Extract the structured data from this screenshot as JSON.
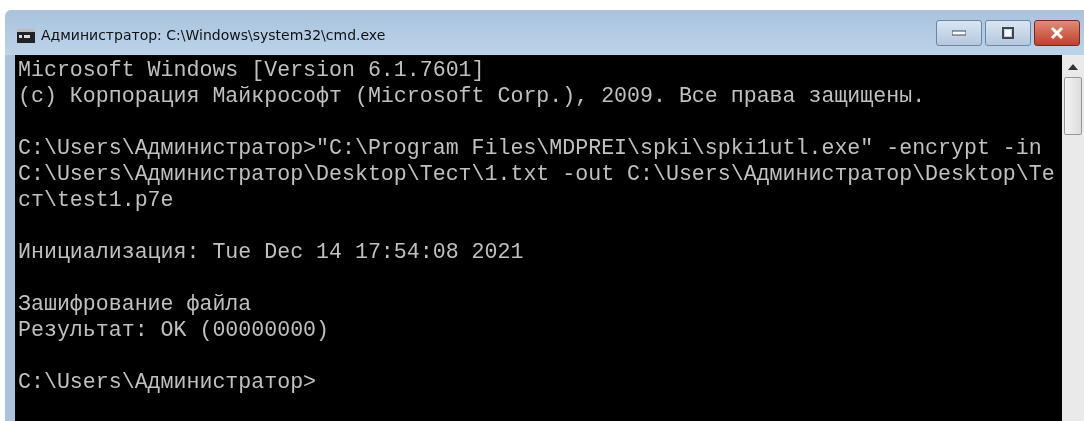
{
  "window": {
    "title": "Администратор: C:\\Windows\\system32\\cmd.exe"
  },
  "console": {
    "blocks": [
      [
        "Microsoft Windows [Version 6.1.7601]",
        "(c) Корпорация Майкрософт (Microsoft Corp.), 2009. Все права защищены."
      ],
      [
        "C:\\Users\\Администратор>\"C:\\Program Files\\MDPREI\\spki\\spki1utl.exe\" -encrypt -in",
        "C:\\Users\\Администратор\\Desktop\\Тест\\1.txt -out C:\\Users\\Администратор\\Desktop\\Те",
        "ст\\test1.p7e"
      ],
      [
        "Инициализация: Tue Dec 14 17:54:08 2021"
      ],
      [
        "Зашифрование файла",
        "Результат: OK (00000000)"
      ],
      [
        "C:\\Users\\Администратор>"
      ]
    ]
  }
}
